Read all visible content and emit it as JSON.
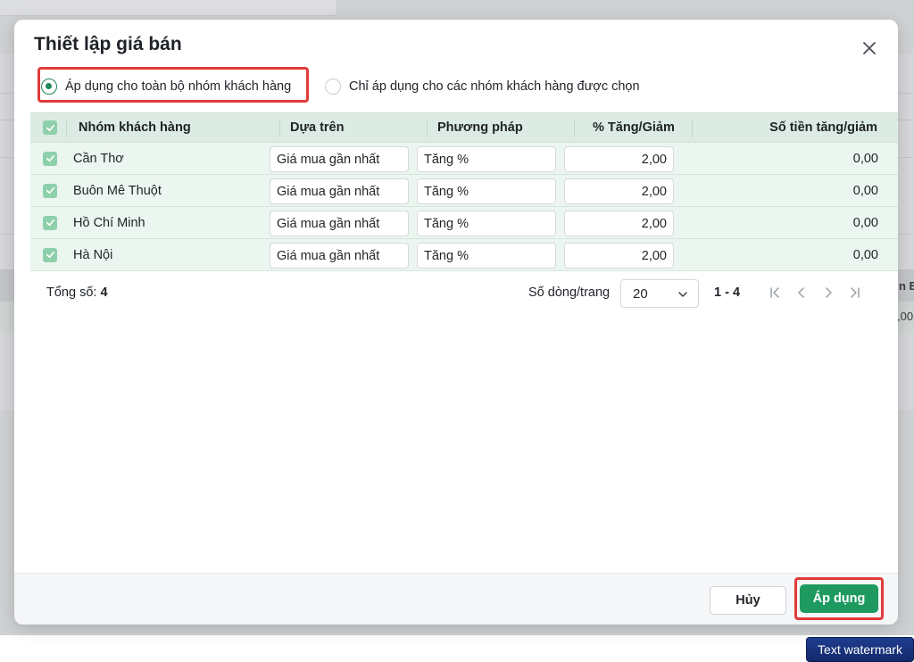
{
  "background": {
    "peek_header_text": "n E",
    "peek_row_text": ",00"
  },
  "modal": {
    "title": "Thiết lập giá bán",
    "close_icon": "close-icon",
    "scope_options": [
      {
        "label": "Áp dụng cho toàn bộ nhóm khách hàng",
        "selected": true
      },
      {
        "label": "Chỉ áp dụng cho các nhóm khách hàng được chọn",
        "selected": false
      }
    ],
    "table": {
      "columns": [
        "Nhóm khách hàng",
        "Dựa trên",
        "Phương pháp",
        "% Tăng/Giảm",
        "Số tiền tăng/giảm"
      ],
      "rows": [
        {
          "group": "Cần Thơ",
          "based_on": "Giá mua gần nhất",
          "method": "Tăng %",
          "percent": "2,00",
          "amount": "0,00",
          "checked": true
        },
        {
          "group": "Buôn Mê Thuột",
          "based_on": "Giá mua gần nhất",
          "method": "Tăng %",
          "percent": "2,00",
          "amount": "0,00",
          "checked": true
        },
        {
          "group": "Hồ Chí Minh",
          "based_on": "Giá mua gần nhất",
          "method": "Tăng %",
          "percent": "2,00",
          "amount": "0,00",
          "checked": true
        },
        {
          "group": "Hà Nội",
          "based_on": "Giá mua gần nhất",
          "method": "Tăng %",
          "percent": "2,00",
          "amount": "0,00",
          "checked": true
        }
      ]
    },
    "pager": {
      "total_label": "Tổng số:",
      "total_value": "4",
      "rows_per_page_label": "Số dòng/trang",
      "rows_per_page_value": "20",
      "range": "1 - 4"
    },
    "footer": {
      "cancel_label": "Hủy",
      "apply_label": "Áp dụng"
    }
  },
  "watermark": "Text watermark",
  "colors": {
    "accent": "#1e9a60",
    "highlight": "#e03a3a",
    "table_header": "#dcebe3",
    "table_row": "#ecf6f0"
  }
}
